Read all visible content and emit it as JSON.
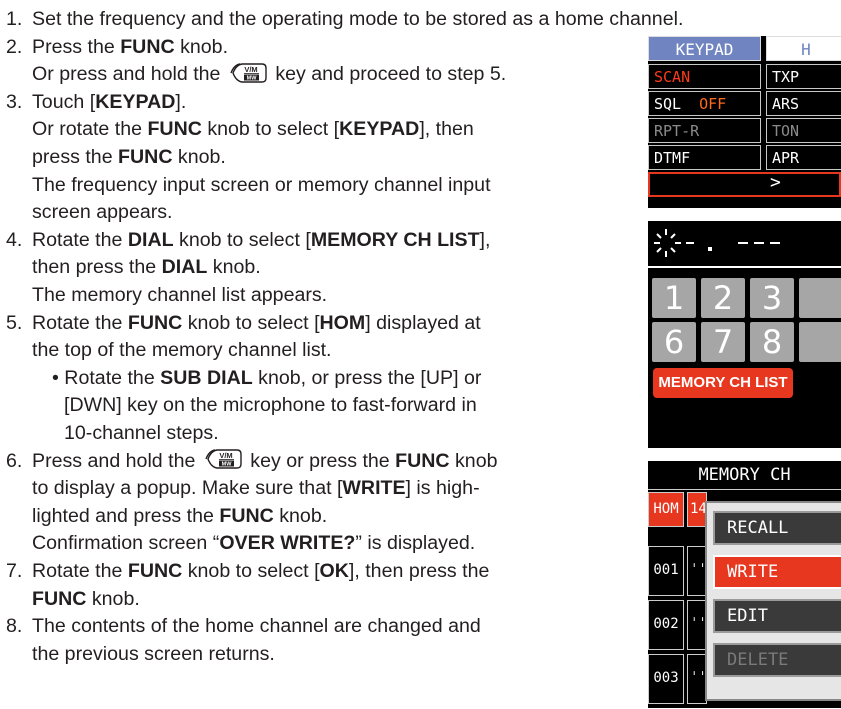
{
  "steps": [
    {
      "num": "1.",
      "lines": [
        [
          {
            "t": "Set the frequency and the operating mode to be stored as a home channel."
          }
        ]
      ]
    },
    {
      "num": "2.",
      "lines": [
        [
          {
            "t": "Press the "
          },
          {
            "t": "FUNC",
            "b": true
          },
          {
            "t": " knob."
          }
        ],
        [
          {
            "t": "Or press and hold the "
          },
          {
            "key": true
          },
          {
            "t": " key and proceed to step 5."
          }
        ]
      ]
    },
    {
      "num": "3.",
      "lines": [
        [
          {
            "t": "Touch ["
          },
          {
            "t": "KEYPAD",
            "b": true
          },
          {
            "t": "]."
          }
        ],
        [
          {
            "t": "Or rotate the "
          },
          {
            "t": "FUNC",
            "b": true
          },
          {
            "t": " knob to select ["
          },
          {
            "t": "KEYPAD",
            "b": true
          },
          {
            "t": "], then"
          }
        ],
        [
          {
            "t": "press the "
          },
          {
            "t": "FUNC",
            "b": true
          },
          {
            "t": " knob."
          }
        ],
        [
          {
            "t": "The frequency input screen or memory channel input"
          }
        ],
        [
          {
            "t": "screen appears."
          }
        ]
      ]
    },
    {
      "num": "4.",
      "lines": [
        [
          {
            "t": "Rotate the "
          },
          {
            "t": "DIAL",
            "b": true
          },
          {
            "t": " knob to select ["
          },
          {
            "t": "MEMORY CH LIST",
            "b": true
          },
          {
            "t": "],"
          }
        ],
        [
          {
            "t": "then press the "
          },
          {
            "t": "DIAL",
            "b": true
          },
          {
            "t": " knob."
          }
        ],
        [
          {
            "t": "The memory channel list appears."
          }
        ]
      ]
    },
    {
      "num": "5.",
      "lines": [
        [
          {
            "t": "Rotate the "
          },
          {
            "t": "FUNC",
            "b": true
          },
          {
            "t": " knob to select ["
          },
          {
            "t": "HOM",
            "b": true
          },
          {
            "t": "] displayed at"
          }
        ],
        [
          {
            "t": "the top of the memory channel list."
          }
        ],
        [
          {
            "t": "• Rotate the "
          },
          {
            "t": "SUB DIAL",
            "b": true
          },
          {
            "t": " knob, or press the [UP] or"
          }
        ],
        [
          {
            "t": "  [DWN] key on the microphone to fast-forward in"
          }
        ],
        [
          {
            "t": "  10-channel steps."
          }
        ]
      ]
    },
    {
      "num": "6.",
      "lines": [
        [
          {
            "t": "Press and hold the "
          },
          {
            "key": true
          },
          {
            "t": " key or press the "
          },
          {
            "t": "FUNC",
            "b": true
          },
          {
            "t": " knob"
          }
        ],
        [
          {
            "t": "to display a popup. Make sure that ["
          },
          {
            "t": "WRITE",
            "b": true
          },
          {
            "t": "] is high-"
          }
        ],
        [
          {
            "t": "lighted and press the "
          },
          {
            "t": "FUNC",
            "b": true
          },
          {
            "t": " knob."
          }
        ],
        [
          {
            "t": "Confirmation screen “"
          },
          {
            "t": "OVER WRITE?",
            "b": true
          },
          {
            "t": "” is displayed."
          }
        ]
      ]
    },
    {
      "num": "7.",
      "lines": [
        [
          {
            "t": "Rotate the "
          },
          {
            "t": "FUNC",
            "b": true
          },
          {
            "t": " knob to select ["
          },
          {
            "t": "OK",
            "b": true
          },
          {
            "t": "], then press the"
          }
        ],
        [
          {
            "t": "FUNC",
            "b": true
          },
          {
            "t": " knob."
          }
        ]
      ]
    },
    {
      "num": "8.",
      "lines": [
        [
          {
            "t": "The contents of the home channel are changed and"
          }
        ],
        [
          {
            "t": "the previous screen returns."
          }
        ]
      ]
    }
  ],
  "key_icon": {
    "top": "V/M",
    "bottom": "MW"
  },
  "panel_menu": {
    "tab_active": "KEYPAD",
    "tab_other": "H",
    "left_items": [
      {
        "label": "SCAN",
        "value": "",
        "color": "#ff3a1a"
      },
      {
        "label": "SQL",
        "value": "OFF",
        "color": "#ffffff",
        "value_color": "#ff6a1a"
      },
      {
        "label": "RPT-R",
        "value": "",
        "color": "#8a8a8a"
      },
      {
        "label": "DTMF",
        "value": "",
        "color": "#ffffff"
      }
    ],
    "right_items": [
      "TXP",
      "ARS",
      "TON",
      "APR"
    ],
    "arrow": ">",
    "accent": "#e8371f",
    "tab_bg": "#6f84c0"
  },
  "panel_keypad": {
    "freq_display": ". ---",
    "keys_row1": [
      "1",
      "2",
      "3"
    ],
    "keys_row2": [
      "6",
      "7",
      "8"
    ],
    "memory_button": "MEMORY CH LIST"
  },
  "panel_list": {
    "header": "MEMORY CH",
    "rows": [
      "HOM",
      "001",
      "002",
      "003"
    ],
    "hom_ch": "14",
    "popup": [
      "RECALL",
      "WRITE",
      "EDIT",
      "DELETE"
    ],
    "popup_selected": "WRITE"
  }
}
